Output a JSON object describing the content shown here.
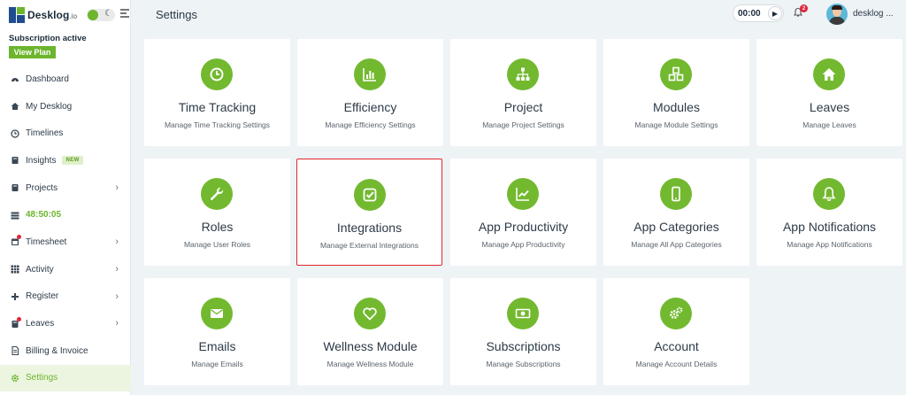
{
  "brand": {
    "name": "Desklog",
    "suffix": ".io"
  },
  "subscription": {
    "status": "Subscription active",
    "button": "View Plan"
  },
  "nav": [
    {
      "label": "Dashboard",
      "icon": "dashboard-icon"
    },
    {
      "label": "My Desklog",
      "icon": "home-icon"
    },
    {
      "label": "Timelines",
      "icon": "clock-icon"
    },
    {
      "label": "Insights",
      "icon": "book-icon",
      "badge": "NEW"
    },
    {
      "label": "Projects",
      "icon": "book-icon"
    },
    {
      "label": "48:50:05",
      "icon": "timer-bars-icon"
    },
    {
      "label": "Timesheet",
      "icon": "calendar-icon"
    },
    {
      "label": "Activity",
      "icon": "grid-icon"
    },
    {
      "label": "Register",
      "icon": "plus-icon"
    },
    {
      "label": "Leaves",
      "icon": "book-icon"
    },
    {
      "label": "Billing & Invoice",
      "icon": "invoice-icon"
    },
    {
      "label": "Settings",
      "icon": "gear-icon"
    }
  ],
  "header": {
    "title": "Settings",
    "timer": "00:00",
    "notification_count": "2",
    "user_name": "desklog ..."
  },
  "cards": [
    {
      "title": "Time Tracking",
      "desc": "Manage Time Tracking Settings",
      "icon": "clock-icon"
    },
    {
      "title": "Efficiency",
      "desc": "Manage Efficiency Settings",
      "icon": "bar-chart-icon"
    },
    {
      "title": "Project",
      "desc": "Manage Project Settings",
      "icon": "sitemap-icon"
    },
    {
      "title": "Modules",
      "desc": "Manage Module Settings",
      "icon": "cubes-icon"
    },
    {
      "title": "Leaves",
      "desc": "Manage Leaves",
      "icon": "house-icon"
    },
    {
      "title": "Roles",
      "desc": "Manage User Roles",
      "icon": "wrench-icon"
    },
    {
      "title": "Integrations",
      "desc": "Manage External Integrations",
      "icon": "check-square-icon"
    },
    {
      "title": "App Productivity",
      "desc": "Manage App Productivity",
      "icon": "line-chart-icon"
    },
    {
      "title": "App Categories",
      "desc": "Manage All App Categories",
      "icon": "mobile-icon"
    },
    {
      "title": "App Notifications",
      "desc": "Manage App Notifications",
      "icon": "bell-icon"
    },
    {
      "title": "Emails",
      "desc": "Manage Emails",
      "icon": "envelope-icon"
    },
    {
      "title": "Wellness Module",
      "desc": "Manage Wellness Module",
      "icon": "heart-icon"
    },
    {
      "title": "Subscriptions",
      "desc": "Manage Subscriptions",
      "icon": "money-icon"
    },
    {
      "title": "Account",
      "desc": "Manage Account Details",
      "icon": "cogs-icon"
    }
  ],
  "colors": {
    "accent": "#72b92f",
    "selected_border": "#e1262c",
    "brand_blue": "#1f4d8f"
  }
}
